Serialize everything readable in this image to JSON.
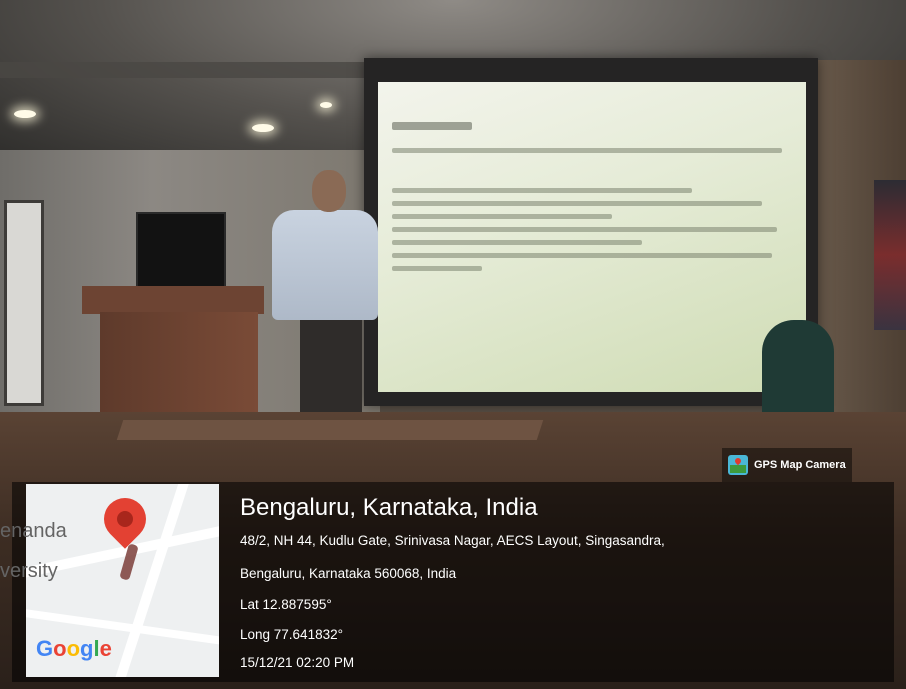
{
  "overlay": {
    "app_label": "GPS Map Camera",
    "app_icon": "gps-map-camera-icon",
    "location_title": "Bengaluru, Karnataka, India",
    "address_line1": "48/2, NH 44, Kudlu Gate, Srinivasa Nagar, AECS Layout, Singasandra,",
    "address_line2": "Bengaluru, Karnataka 560068, India",
    "latitude": "Lat 12.887595°",
    "longitude": "Long 77.641832°",
    "datetime": "15/12/21 02:20 PM"
  },
  "map": {
    "label_fragment_1": "enanda",
    "label_fragment_2": "versity",
    "logo_text": "Google",
    "pin_icon": "location-pin-icon"
  },
  "colors": {
    "pin_red": "#e34133",
    "panel_bg": "rgba(0,0,0,0.55)"
  }
}
